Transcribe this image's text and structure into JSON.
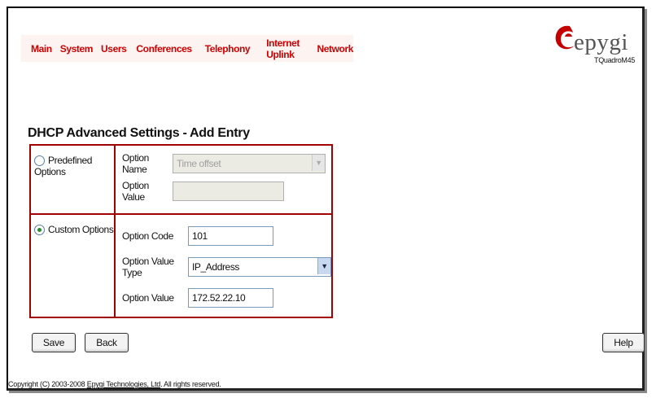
{
  "nav": {
    "items": [
      "Main",
      "System",
      "Users",
      "Conferences",
      "Telephony",
      "Internet Uplink",
      "Network"
    ]
  },
  "logo": {
    "brand": "epygi",
    "model": "TQuadroM45",
    "icon": "epygi-swirl-logo",
    "brand_color": "#cc0000"
  },
  "page": {
    "title": "DHCP Advanced Settings - Add Entry"
  },
  "predefined": {
    "radio_label": "Predefined Options",
    "checked": false,
    "option_name_label": "Option Name",
    "option_name_value": "Time offset",
    "option_value_label": "Option Value",
    "option_value_value": ""
  },
  "custom": {
    "radio_label": "Custom Options",
    "checked": true,
    "option_code_label": "Option Code",
    "option_code_value": "101",
    "option_value_type_label": "Option Value Type",
    "option_value_type_value": "IP_Address",
    "option_value_label": "Option Value",
    "option_value_value": "172.52.22.10"
  },
  "buttons": {
    "save": "Save",
    "back": "Back",
    "help": "Help"
  },
  "footer": {
    "prefix": "Copyright (C) 2003-2008 ",
    "link": "Epygi Technologies, Ltd",
    "suffix": ". All rights reserved."
  },
  "colors": {
    "accent": "#cc0000",
    "table_border": "#a00000",
    "radio_selected": "#2a8a2a"
  }
}
